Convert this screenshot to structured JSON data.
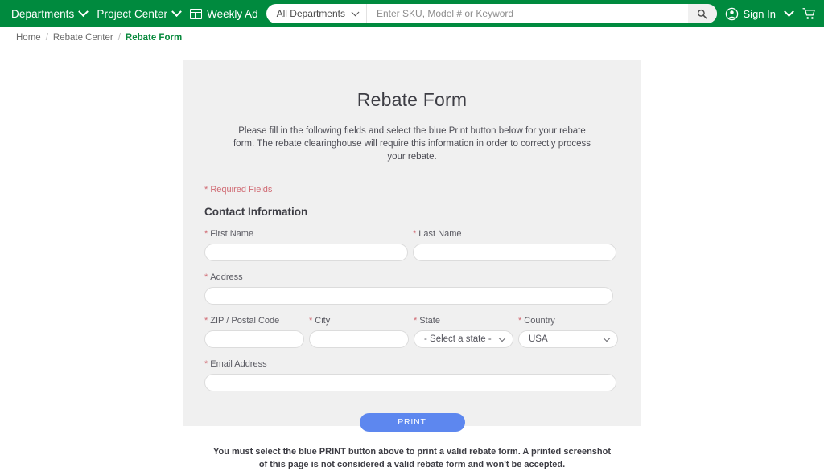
{
  "topnav": {
    "departments_label": "Departments",
    "project_center_label": "Project Center",
    "weekly_ad_label": "Weekly Ad",
    "dept_select_value": "All Departments",
    "search_placeholder": "Enter SKU, Model # or Keyword",
    "search_value": "",
    "signin_label": "Sign In",
    "brand_green": "#008a3e"
  },
  "breadcrumb": {
    "home": "Home",
    "sep1": "/",
    "rebate_center": "Rebate Center",
    "sep2": "/",
    "current": "Rebate Form",
    "current_color": "#0a8a3e"
  },
  "form": {
    "title": "Rebate Form",
    "description": "Please fill in the following fields and select the blue Print button below for your rebate form. The rebate clearinghouse will require this information in order to correctly process your rebate.",
    "required_note": "* Required Fields",
    "section_title": "Contact Information",
    "fields": {
      "first_name": {
        "label": "First Name",
        "required": "*",
        "value": ""
      },
      "last_name": {
        "label": "Last Name",
        "required": "*",
        "value": ""
      },
      "address": {
        "label": "Address",
        "required": "*",
        "value": ""
      },
      "zip": {
        "label": "ZIP / Postal Code",
        "required": "*",
        "value": ""
      },
      "city": {
        "label": "City",
        "required": "*",
        "value": ""
      },
      "state": {
        "label": "State",
        "required": "*",
        "selected": "- Select a state -"
      },
      "country": {
        "label": "Country",
        "required": "*",
        "selected": "USA"
      },
      "email": {
        "label": "Email Address",
        "required": "*",
        "value": ""
      }
    },
    "print_label": "PRINT",
    "print_color": "#5d87ef",
    "disclaimer": "You must select the blue PRINT button above to print a valid rebate form. A printed screenshot of this page is not considered a valid rebate form and won't be accepted."
  }
}
